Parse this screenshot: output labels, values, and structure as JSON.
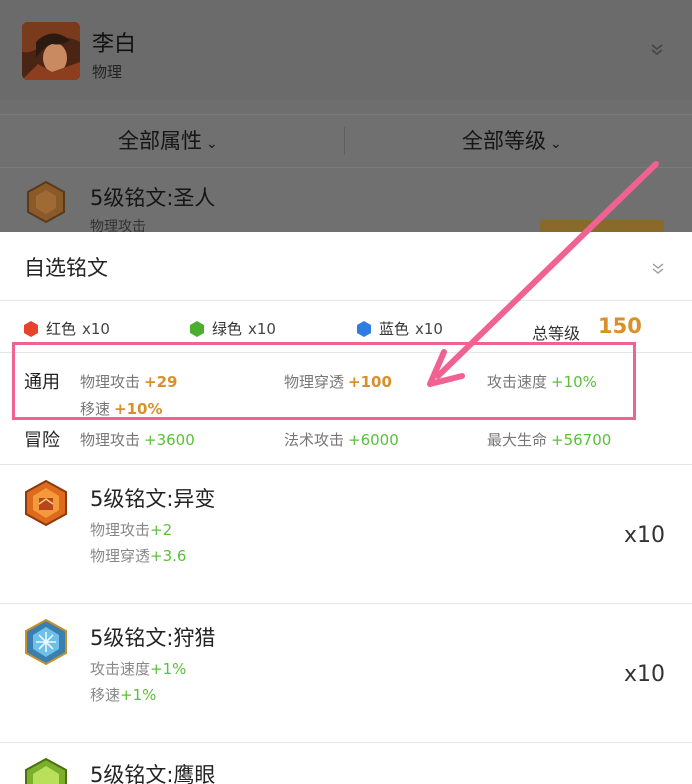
{
  "hero": {
    "name": "李白",
    "type": "物理"
  },
  "filters": {
    "attr_label": "全部属性",
    "level_label": "全部等级",
    "caret": "⌄"
  },
  "bg_item": {
    "name": "5级铭文:圣人",
    "stat_prefix": "物理攻击"
  },
  "sheet": {
    "title": "自选铭文"
  },
  "colors": [
    {
      "label": "红色",
      "count": "x10",
      "color": "#e8412c"
    },
    {
      "label": "绿色",
      "count": "x10",
      "color": "#4cae2f"
    },
    {
      "label": "蓝色",
      "count": "x10",
      "color": "#2f7de1"
    }
  ],
  "total": {
    "label": "总等级",
    "value": "150"
  },
  "general": {
    "category": "通用",
    "attrs": [
      {
        "name": "物理攻击",
        "value": "+29"
      },
      {
        "name": "物理穿透",
        "value": "+100"
      },
      {
        "name": "攻击速度",
        "value": "+10%"
      },
      {
        "name": "移速",
        "value": "+10%"
      }
    ]
  },
  "adventure": {
    "category": "冒险",
    "attrs": [
      {
        "name": "物理攻击",
        "value": "+3600"
      },
      {
        "name": "法术攻击",
        "value": "+6000"
      },
      {
        "name": "最大生命",
        "value": "+56700"
      }
    ]
  },
  "runes": [
    {
      "name": "5级铭文:异变",
      "stats": [
        {
          "name": "物理攻击",
          "value": "+2"
        },
        {
          "name": "物理穿透",
          "value": "+3.6"
        }
      ],
      "count": "x10"
    },
    {
      "name": "5级铭文:狩猎",
      "stats": [
        {
          "name": "攻击速度",
          "value": "+1%"
        },
        {
          "name": "移速",
          "value": "+1%"
        }
      ],
      "count": "x10"
    },
    {
      "name": "5级铭文:鹰眼",
      "stats": [],
      "count": ""
    }
  ],
  "accent_colors": {
    "highlight": "#f06292",
    "orange": "#d8902a",
    "green": "#5bbf3a"
  }
}
